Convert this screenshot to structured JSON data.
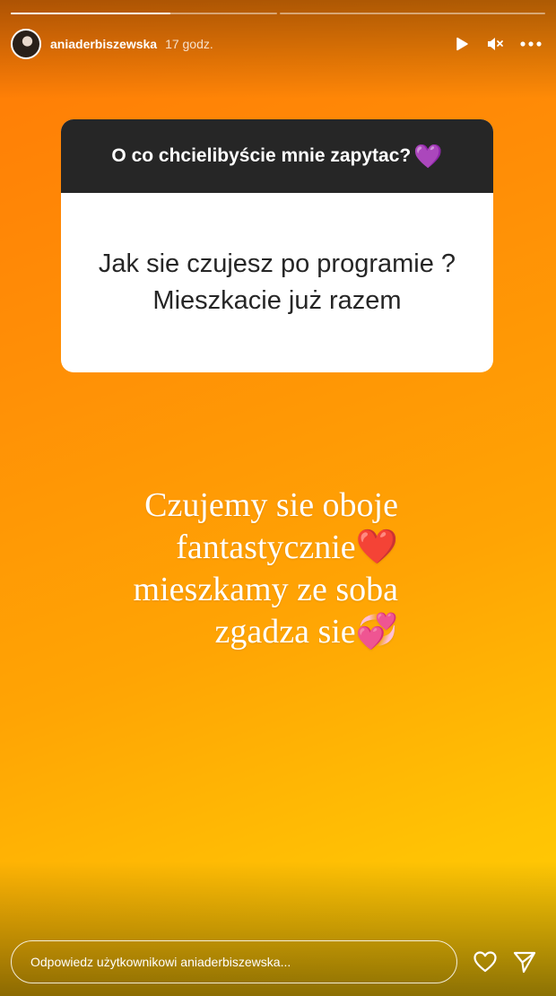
{
  "story": {
    "progress": {
      "segments": 2,
      "current": 0,
      "current_fraction": 0.6
    },
    "user": {
      "username": "aniaderbiszewska",
      "time": "17 godz."
    },
    "controls": {
      "play_icon": "play-icon",
      "mute_icon": "mute-icon",
      "more_icon": "more-icon"
    }
  },
  "question_sticker": {
    "prompt": "O co chcielibyście mnie zapytac?",
    "prompt_emoji": "💜",
    "question": "Jak sie czujesz po programie ? Mieszkacie już razem"
  },
  "answer": {
    "line1": "Czujemy sie oboje",
    "line2": "fantastycznie",
    "line2_emoji": "❤️",
    "line3": "mieszkamy ze soba",
    "line4": "zgadza sie",
    "line4_emoji": "💞"
  },
  "footer": {
    "reply_placeholder": "Odpowiedz użytkownikowi aniaderbiszewska...",
    "like_icon": "heart-icon",
    "send_icon": "send-icon"
  },
  "colors": {
    "background_top": "#ff7a06",
    "background_bottom": "#ffcf06",
    "card_header": "#262626",
    "card_body": "#ffffff"
  }
}
